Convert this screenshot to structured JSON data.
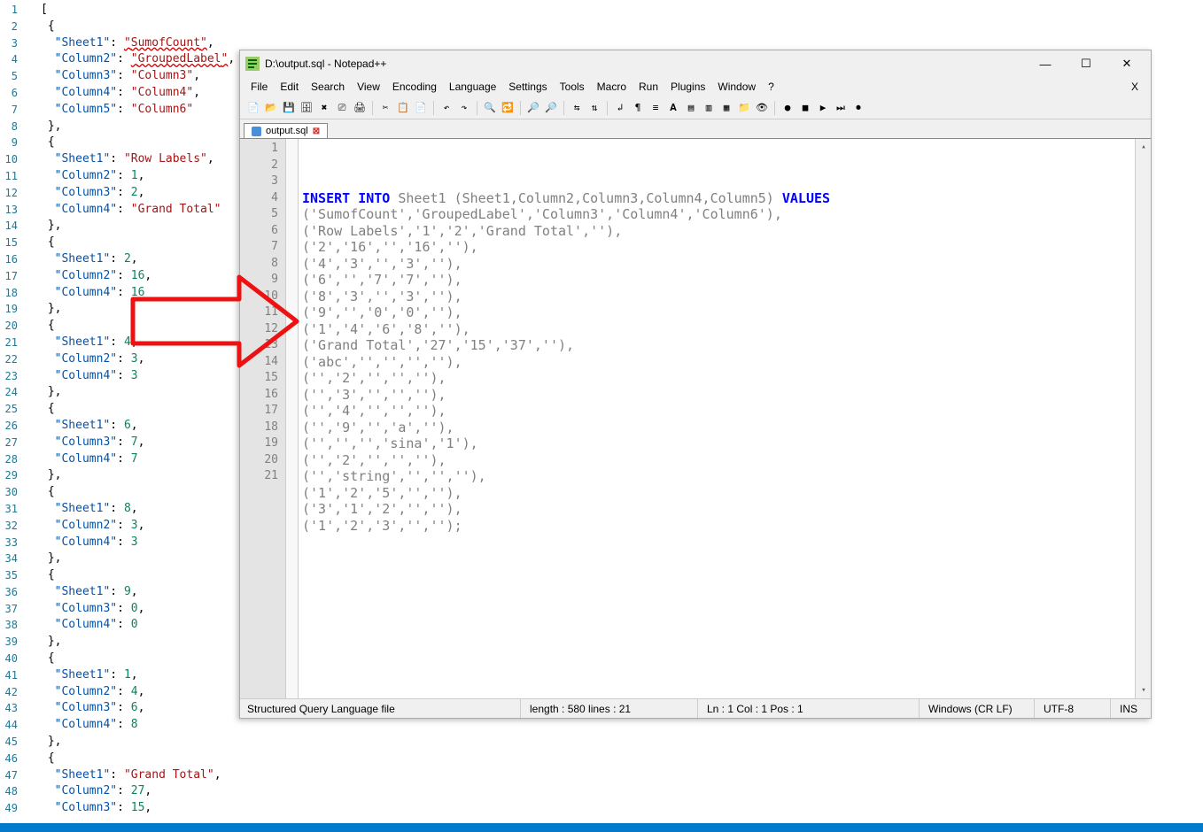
{
  "left_json_lines": [
    {
      "n": 1,
      "raw": "[",
      "tokens": [
        {
          "t": "p",
          "v": "["
        }
      ]
    },
    {
      "n": 2,
      "raw": " {",
      "tokens": [
        {
          "t": "p",
          "v": " {"
        }
      ]
    },
    {
      "n": 3,
      "tokens": [
        {
          "t": "p",
          "v": "  "
        },
        {
          "t": "key",
          "v": "\"Sheet1\""
        },
        {
          "t": "p",
          "v": ": "
        },
        {
          "t": "str",
          "v": "\"",
          "sq": true
        },
        {
          "t": "str",
          "v": "SumofCount",
          "sq": true
        },
        {
          "t": "str",
          "v": "\"",
          "sq": true
        },
        {
          "t": "p",
          "v": ","
        }
      ]
    },
    {
      "n": 4,
      "tokens": [
        {
          "t": "p",
          "v": "  "
        },
        {
          "t": "key",
          "v": "\"Column2\""
        },
        {
          "t": "p",
          "v": ": "
        },
        {
          "t": "str",
          "v": "\"",
          "sq": true
        },
        {
          "t": "str",
          "v": "GroupedLabel",
          "sq": true
        },
        {
          "t": "str",
          "v": "\"",
          "sq": true
        },
        {
          "t": "p",
          "v": ","
        }
      ]
    },
    {
      "n": 5,
      "tokens": [
        {
          "t": "p",
          "v": "  "
        },
        {
          "t": "key",
          "v": "\"Column3\""
        },
        {
          "t": "p",
          "v": ": "
        },
        {
          "t": "str",
          "v": "\"Column3\""
        },
        {
          "t": "p",
          "v": ","
        }
      ]
    },
    {
      "n": 6,
      "tokens": [
        {
          "t": "p",
          "v": "  "
        },
        {
          "t": "key",
          "v": "\"Column4\""
        },
        {
          "t": "p",
          "v": ": "
        },
        {
          "t": "str",
          "v": "\"Column4\""
        },
        {
          "t": "p",
          "v": ","
        }
      ]
    },
    {
      "n": 7,
      "tokens": [
        {
          "t": "p",
          "v": "  "
        },
        {
          "t": "key",
          "v": "\"Column5\""
        },
        {
          "t": "p",
          "v": ": "
        },
        {
          "t": "str",
          "v": "\"Column6\""
        }
      ]
    },
    {
      "n": 8,
      "tokens": [
        {
          "t": "p",
          "v": " },"
        }
      ]
    },
    {
      "n": 9,
      "tokens": [
        {
          "t": "p",
          "v": " {"
        }
      ]
    },
    {
      "n": 10,
      "tokens": [
        {
          "t": "p",
          "v": "  "
        },
        {
          "t": "key",
          "v": "\"Sheet1\""
        },
        {
          "t": "p",
          "v": ": "
        },
        {
          "t": "str",
          "v": "\"Row Labels\""
        },
        {
          "t": "p",
          "v": ","
        }
      ]
    },
    {
      "n": 11,
      "tokens": [
        {
          "t": "p",
          "v": "  "
        },
        {
          "t": "key",
          "v": "\"Column2\""
        },
        {
          "t": "p",
          "v": ": "
        },
        {
          "t": "num",
          "v": "1"
        },
        {
          "t": "p",
          "v": ","
        }
      ]
    },
    {
      "n": 12,
      "tokens": [
        {
          "t": "p",
          "v": "  "
        },
        {
          "t": "key",
          "v": "\"Column3\""
        },
        {
          "t": "p",
          "v": ": "
        },
        {
          "t": "num",
          "v": "2"
        },
        {
          "t": "p",
          "v": ","
        }
      ]
    },
    {
      "n": 13,
      "tokens": [
        {
          "t": "p",
          "v": "  "
        },
        {
          "t": "key",
          "v": "\"Column4\""
        },
        {
          "t": "p",
          "v": ": "
        },
        {
          "t": "str",
          "v": "\"Grand Total\""
        }
      ]
    },
    {
      "n": 14,
      "tokens": [
        {
          "t": "p",
          "v": " },"
        }
      ]
    },
    {
      "n": 15,
      "tokens": [
        {
          "t": "p",
          "v": " {"
        }
      ]
    },
    {
      "n": 16,
      "tokens": [
        {
          "t": "p",
          "v": "  "
        },
        {
          "t": "key",
          "v": "\"Sheet1\""
        },
        {
          "t": "p",
          "v": ": "
        },
        {
          "t": "num",
          "v": "2"
        },
        {
          "t": "p",
          "v": ","
        }
      ]
    },
    {
      "n": 17,
      "tokens": [
        {
          "t": "p",
          "v": "  "
        },
        {
          "t": "key",
          "v": "\"Column2\""
        },
        {
          "t": "p",
          "v": ": "
        },
        {
          "t": "num",
          "v": "16"
        },
        {
          "t": "p",
          "v": ","
        }
      ]
    },
    {
      "n": 18,
      "tokens": [
        {
          "t": "p",
          "v": "  "
        },
        {
          "t": "key",
          "v": "\"Column4\""
        },
        {
          "t": "p",
          "v": ": "
        },
        {
          "t": "num",
          "v": "16"
        }
      ]
    },
    {
      "n": 19,
      "tokens": [
        {
          "t": "p",
          "v": " },"
        }
      ]
    },
    {
      "n": 20,
      "tokens": [
        {
          "t": "p",
          "v": " {"
        }
      ]
    },
    {
      "n": 21,
      "tokens": [
        {
          "t": "p",
          "v": "  "
        },
        {
          "t": "key",
          "v": "\"Sheet1\""
        },
        {
          "t": "p",
          "v": ": "
        },
        {
          "t": "num",
          "v": "4"
        },
        {
          "t": "p",
          "v": ","
        }
      ]
    },
    {
      "n": 22,
      "tokens": [
        {
          "t": "p",
          "v": "  "
        },
        {
          "t": "key",
          "v": "\"Column2\""
        },
        {
          "t": "p",
          "v": ": "
        },
        {
          "t": "num",
          "v": "3"
        },
        {
          "t": "p",
          "v": ","
        }
      ]
    },
    {
      "n": 23,
      "tokens": [
        {
          "t": "p",
          "v": "  "
        },
        {
          "t": "key",
          "v": "\"Column4\""
        },
        {
          "t": "p",
          "v": ": "
        },
        {
          "t": "num",
          "v": "3"
        }
      ]
    },
    {
      "n": 24,
      "tokens": [
        {
          "t": "p",
          "v": " },"
        }
      ]
    },
    {
      "n": 25,
      "tokens": [
        {
          "t": "p",
          "v": " {"
        }
      ]
    },
    {
      "n": 26,
      "tokens": [
        {
          "t": "p",
          "v": "  "
        },
        {
          "t": "key",
          "v": "\"Sheet1\""
        },
        {
          "t": "p",
          "v": ": "
        },
        {
          "t": "num",
          "v": "6"
        },
        {
          "t": "p",
          "v": ","
        }
      ]
    },
    {
      "n": 27,
      "tokens": [
        {
          "t": "p",
          "v": "  "
        },
        {
          "t": "key",
          "v": "\"Column3\""
        },
        {
          "t": "p",
          "v": ": "
        },
        {
          "t": "num",
          "v": "7"
        },
        {
          "t": "p",
          "v": ","
        }
      ]
    },
    {
      "n": 28,
      "tokens": [
        {
          "t": "p",
          "v": "  "
        },
        {
          "t": "key",
          "v": "\"Column4\""
        },
        {
          "t": "p",
          "v": ": "
        },
        {
          "t": "num",
          "v": "7"
        }
      ]
    },
    {
      "n": 29,
      "tokens": [
        {
          "t": "p",
          "v": " },"
        }
      ]
    },
    {
      "n": 30,
      "tokens": [
        {
          "t": "p",
          "v": " {"
        }
      ]
    },
    {
      "n": 31,
      "tokens": [
        {
          "t": "p",
          "v": "  "
        },
        {
          "t": "key",
          "v": "\"Sheet1\""
        },
        {
          "t": "p",
          "v": ": "
        },
        {
          "t": "num",
          "v": "8"
        },
        {
          "t": "p",
          "v": ","
        }
      ]
    },
    {
      "n": 32,
      "tokens": [
        {
          "t": "p",
          "v": "  "
        },
        {
          "t": "key",
          "v": "\"Column2\""
        },
        {
          "t": "p",
          "v": ": "
        },
        {
          "t": "num",
          "v": "3"
        },
        {
          "t": "p",
          "v": ","
        }
      ]
    },
    {
      "n": 33,
      "tokens": [
        {
          "t": "p",
          "v": "  "
        },
        {
          "t": "key",
          "v": "\"Column4\""
        },
        {
          "t": "p",
          "v": ": "
        },
        {
          "t": "num",
          "v": "3"
        }
      ]
    },
    {
      "n": 34,
      "tokens": [
        {
          "t": "p",
          "v": " },"
        }
      ]
    },
    {
      "n": 35,
      "tokens": [
        {
          "t": "p",
          "v": " {"
        }
      ]
    },
    {
      "n": 36,
      "tokens": [
        {
          "t": "p",
          "v": "  "
        },
        {
          "t": "key",
          "v": "\"Sheet1\""
        },
        {
          "t": "p",
          "v": ": "
        },
        {
          "t": "num",
          "v": "9"
        },
        {
          "t": "p",
          "v": ","
        }
      ]
    },
    {
      "n": 37,
      "tokens": [
        {
          "t": "p",
          "v": "  "
        },
        {
          "t": "key",
          "v": "\"Column3\""
        },
        {
          "t": "p",
          "v": ": "
        },
        {
          "t": "num",
          "v": "0"
        },
        {
          "t": "p",
          "v": ","
        }
      ]
    },
    {
      "n": 38,
      "tokens": [
        {
          "t": "p",
          "v": "  "
        },
        {
          "t": "key",
          "v": "\"Column4\""
        },
        {
          "t": "p",
          "v": ": "
        },
        {
          "t": "num",
          "v": "0"
        }
      ]
    },
    {
      "n": 39,
      "tokens": [
        {
          "t": "p",
          "v": " },"
        }
      ]
    },
    {
      "n": 40,
      "tokens": [
        {
          "t": "p",
          "v": " {"
        }
      ]
    },
    {
      "n": 41,
      "tokens": [
        {
          "t": "p",
          "v": "  "
        },
        {
          "t": "key",
          "v": "\"Sheet1\""
        },
        {
          "t": "p",
          "v": ": "
        },
        {
          "t": "num",
          "v": "1"
        },
        {
          "t": "p",
          "v": ","
        }
      ]
    },
    {
      "n": 42,
      "tokens": [
        {
          "t": "p",
          "v": "  "
        },
        {
          "t": "key",
          "v": "\"Column2\""
        },
        {
          "t": "p",
          "v": ": "
        },
        {
          "t": "num",
          "v": "4"
        },
        {
          "t": "p",
          "v": ","
        }
      ]
    },
    {
      "n": 43,
      "tokens": [
        {
          "t": "p",
          "v": "  "
        },
        {
          "t": "key",
          "v": "\"Column3\""
        },
        {
          "t": "p",
          "v": ": "
        },
        {
          "t": "num",
          "v": "6"
        },
        {
          "t": "p",
          "v": ","
        }
      ]
    },
    {
      "n": 44,
      "tokens": [
        {
          "t": "p",
          "v": "  "
        },
        {
          "t": "key",
          "v": "\"Column4\""
        },
        {
          "t": "p",
          "v": ": "
        },
        {
          "t": "num",
          "v": "8"
        }
      ]
    },
    {
      "n": 45,
      "tokens": [
        {
          "t": "p",
          "v": " },"
        }
      ]
    },
    {
      "n": 46,
      "tokens": [
        {
          "t": "p",
          "v": " {"
        }
      ]
    },
    {
      "n": 47,
      "tokens": [
        {
          "t": "p",
          "v": "  "
        },
        {
          "t": "key",
          "v": "\"Sheet1\""
        },
        {
          "t": "p",
          "v": ": "
        },
        {
          "t": "str",
          "v": "\"Grand Total\""
        },
        {
          "t": "p",
          "v": ","
        }
      ]
    },
    {
      "n": 48,
      "tokens": [
        {
          "t": "p",
          "v": "  "
        },
        {
          "t": "key",
          "v": "\"Column2\""
        },
        {
          "t": "p",
          "v": ": "
        },
        {
          "t": "num",
          "v": "27"
        },
        {
          "t": "p",
          "v": ","
        }
      ]
    },
    {
      "n": 49,
      "tokens": [
        {
          "t": "p",
          "v": "  "
        },
        {
          "t": "key",
          "v": "\"Column3\""
        },
        {
          "t": "p",
          "v": ": "
        },
        {
          "t": "num",
          "v": "15"
        },
        {
          "t": "p",
          "v": ","
        }
      ]
    }
  ],
  "npp": {
    "title": "D:\\output.sql - Notepad++",
    "menu": [
      "File",
      "Edit",
      "Search",
      "View",
      "Encoding",
      "Language",
      "Settings",
      "Tools",
      "Macro",
      "Run",
      "Plugins",
      "Window",
      "?"
    ],
    "tab": "output.sql",
    "sql_lines": [
      [
        {
          "t": "kw",
          "v": "INSERT INTO"
        },
        {
          "t": "txt",
          "v": " Sheet1 (Sheet1,Column2,Column3,Column4,Column5) "
        },
        {
          "t": "kw",
          "v": "VALUES"
        }
      ],
      [
        {
          "t": "txt",
          "v": "('SumofCount','GroupedLabel','Column3','Column4','Column6'),"
        }
      ],
      [
        {
          "t": "txt",
          "v": "('Row Labels','1','2','Grand Total',''),"
        }
      ],
      [
        {
          "t": "txt",
          "v": "('2','16','','16',''),"
        }
      ],
      [
        {
          "t": "txt",
          "v": "('4','3','','3',''),"
        }
      ],
      [
        {
          "t": "txt",
          "v": "('6','','7','7',''),"
        }
      ],
      [
        {
          "t": "txt",
          "v": "('8','3','','3',''),"
        }
      ],
      [
        {
          "t": "txt",
          "v": "('9','','0','0',''),"
        }
      ],
      [
        {
          "t": "txt",
          "v": "('1','4','6','8',''),"
        }
      ],
      [
        {
          "t": "txt",
          "v": "('Grand Total','27','15','37',''),"
        }
      ],
      [
        {
          "t": "txt",
          "v": "('abc','','','',''),"
        }
      ],
      [
        {
          "t": "txt",
          "v": "('','2','','',''),"
        }
      ],
      [
        {
          "t": "txt",
          "v": "('','3','','',''),"
        }
      ],
      [
        {
          "t": "txt",
          "v": "('','4','','',''),"
        }
      ],
      [
        {
          "t": "txt",
          "v": "('','9','','a',''),"
        }
      ],
      [
        {
          "t": "txt",
          "v": "('','','','sina','1'),"
        }
      ],
      [
        {
          "t": "txt",
          "v": "('','2','','',''),"
        }
      ],
      [
        {
          "t": "txt",
          "v": "('','string','','',''),"
        }
      ],
      [
        {
          "t": "txt",
          "v": "('1','2','5','',''),"
        }
      ],
      [
        {
          "t": "txt",
          "v": "('3','1','2','',''),"
        }
      ],
      [
        {
          "t": "txt",
          "v": "('1','2','3','','');"
        }
      ]
    ],
    "status": {
      "lang": "Structured Query Language file",
      "length": "length : 580    lines : 21",
      "pos": "Ln : 1    Col : 1    Pos : 1",
      "eol": "Windows (CR LF)",
      "enc": "UTF-8",
      "ins": "INS"
    }
  },
  "toolbar_icons": [
    "new",
    "open",
    "save",
    "saveall",
    "close",
    "closeall",
    "print",
    "|",
    "cut",
    "copy",
    "paste",
    "|",
    "undo",
    "redo",
    "|",
    "find",
    "replace",
    "|",
    "zoomin",
    "zoomout",
    "|",
    "sync",
    "sync2",
    "|",
    "wrap",
    "allchars",
    "indent",
    "lang",
    "doc",
    "doc2",
    "doc3",
    "dir",
    "monitor",
    "|",
    "rec",
    "stop",
    "play",
    "playn",
    "save-macro"
  ]
}
